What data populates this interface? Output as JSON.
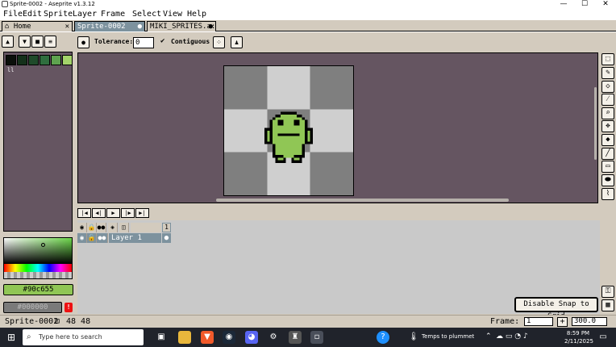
{
  "window": {
    "title": "Sprite-0002 - Aseprite v1.3.12",
    "controls": {
      "minimize": "—",
      "maximize": "☐",
      "close": "✕"
    }
  },
  "menu": [
    "File",
    "Edit",
    "Sprite",
    "Layer",
    "Frame",
    "Select",
    "View",
    "Help"
  ],
  "tabs": [
    {
      "label": "Home",
      "close": "✕"
    },
    {
      "label": "Sprite-0002",
      "close": "●"
    },
    {
      "label": "MIKI_SPRITES.a:",
      "close": "●"
    }
  ],
  "left_panel": {
    "palette_index_label": "ll",
    "swatches": [
      "#0a0f0a",
      "#14301a",
      "#1f4a2a",
      "#2f6e3e",
      "#5ea34f",
      "#a3d36a"
    ],
    "fg_color": "#90c655",
    "bg_color": "#000000",
    "warn": "!"
  },
  "context_bar": {
    "tolerance_label": "Tolerance:",
    "tolerance_value": "0",
    "contiguous_label": "Contiguous",
    "contiguous_check": "✔"
  },
  "timeline": {
    "frame_number": "1",
    "layer_name": "Layer 1"
  },
  "snap_button": "Disable Snap to Grid",
  "status": {
    "sprite_name": "Sprite-0002",
    "size": "48 48",
    "frame_label": "Frame:",
    "frame_value": "1",
    "add_frame": "+",
    "zoom": "300.0"
  },
  "taskbar": {
    "search_placeholder": "Type here to search",
    "weather": "Temps to plummet",
    "time": "8:59 PM",
    "date": "2/11/2025"
  },
  "sprite_colors": {
    "outline": "#000000",
    "body": "#90c655",
    "checker_light": "#cfcfcf",
    "checker_dark": "#7f7f7f"
  }
}
